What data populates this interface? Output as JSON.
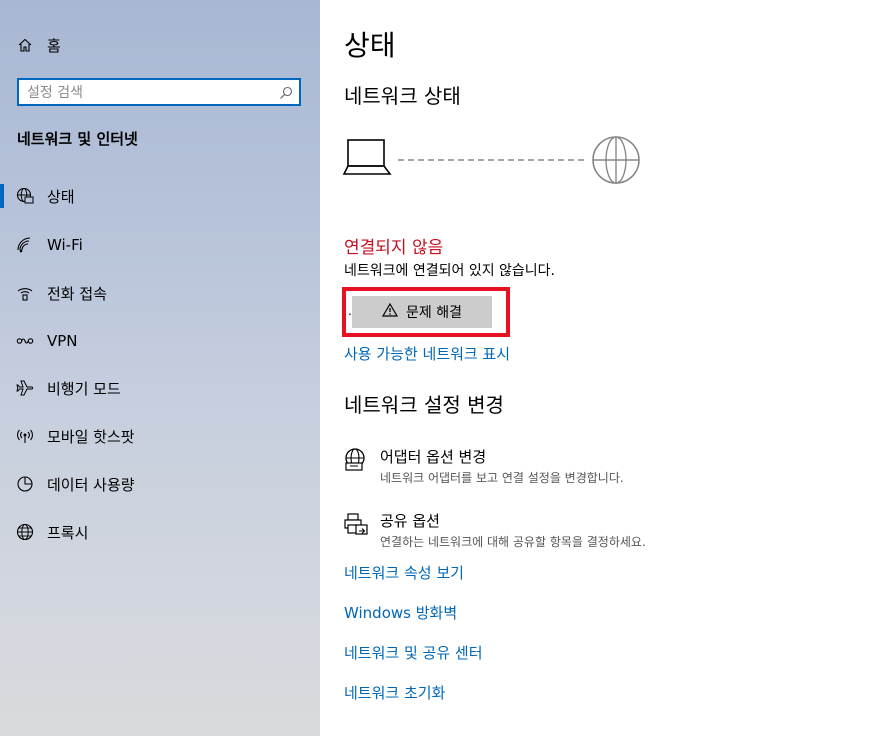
{
  "sidebar": {
    "home_label": "홈",
    "search_placeholder": "설정 검색",
    "section_title": "네트워크 및 인터넷",
    "items": [
      {
        "label": "상태",
        "icon": "network-status-icon"
      },
      {
        "label": "Wi-Fi",
        "icon": "wifi-icon"
      },
      {
        "label": "전화 접속",
        "icon": "dialup-icon"
      },
      {
        "label": "VPN",
        "icon": "vpn-icon"
      },
      {
        "label": "비행기 모드",
        "icon": "airplane-icon"
      },
      {
        "label": "모바일 핫스팟",
        "icon": "hotspot-icon"
      },
      {
        "label": "데이터 사용량",
        "icon": "data-usage-icon"
      },
      {
        "label": "프록시",
        "icon": "globe-icon"
      }
    ]
  },
  "main": {
    "title": "상태",
    "network_status_heading": "네트워크 상태",
    "status_title": "연결되지 않음",
    "status_desc": "네트워크에 연결되어 있지 않습니다.",
    "dot": ".",
    "troubleshoot_label": "문제 해결",
    "show_networks_link": "사용 가능한 네트워크 표시",
    "change_heading": "네트워크 설정 변경",
    "options": [
      {
        "title": "어댑터 옵션 변경",
        "desc": "네트워크 어댑터를 보고 연결 설정을 변경합니다.",
        "icon": "adapter-icon"
      },
      {
        "title": "공유 옵션",
        "desc": "연결하는 네트워크에 대해 공유할 항목을 결정하세요.",
        "icon": "sharing-icon"
      }
    ],
    "links": [
      "네트워크 속성 보기",
      "Windows 방화벽",
      "네트워크 및 공유 센터",
      "네트워크 초기화"
    ]
  },
  "colors": {
    "accent": "#0067c0",
    "link": "#0067b8",
    "error": "#c50f1f",
    "highlight": "#e81123"
  }
}
